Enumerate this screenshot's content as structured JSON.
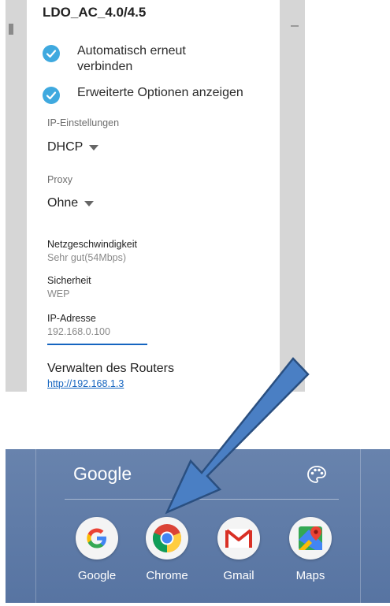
{
  "wifi_dialog": {
    "title": "LDO_AC_4.0/4.5",
    "options": [
      {
        "label": "Automatisch erneut verbinden",
        "checked": true
      },
      {
        "label": "Erweiterte Optionen anzeigen",
        "checked": true
      }
    ],
    "ip_settings": {
      "label": "IP-Einstellungen",
      "value": "DHCP"
    },
    "proxy": {
      "label": "Proxy",
      "value": "Ohne"
    },
    "info": [
      {
        "label": "Netzgeschwindigkeit",
        "value": "Sehr gut(54Mbps)"
      },
      {
        "label": "Sicherheit",
        "value": "WEP"
      },
      {
        "label": "IP-Adresse",
        "value": "192.168.0.100"
      }
    ],
    "router": {
      "label": "Verwalten des Routers",
      "link": "http://192.168.1.3"
    }
  },
  "home_folder": {
    "title": "Google",
    "palette_icon": "palette-icon",
    "apps": [
      {
        "label": "Google",
        "icon": "google-g-icon"
      },
      {
        "label": "Chrome",
        "icon": "chrome-icon"
      },
      {
        "label": "Gmail",
        "icon": "gmail-icon"
      },
      {
        "label": "Maps",
        "icon": "maps-icon"
      }
    ]
  },
  "colors": {
    "check_blue": "#3fa9df",
    "link_blue": "#1565c0",
    "home_bg": "#5e7aa6",
    "arrow_fill": "#4a7fc4",
    "arrow_stroke": "#2a4f80"
  }
}
